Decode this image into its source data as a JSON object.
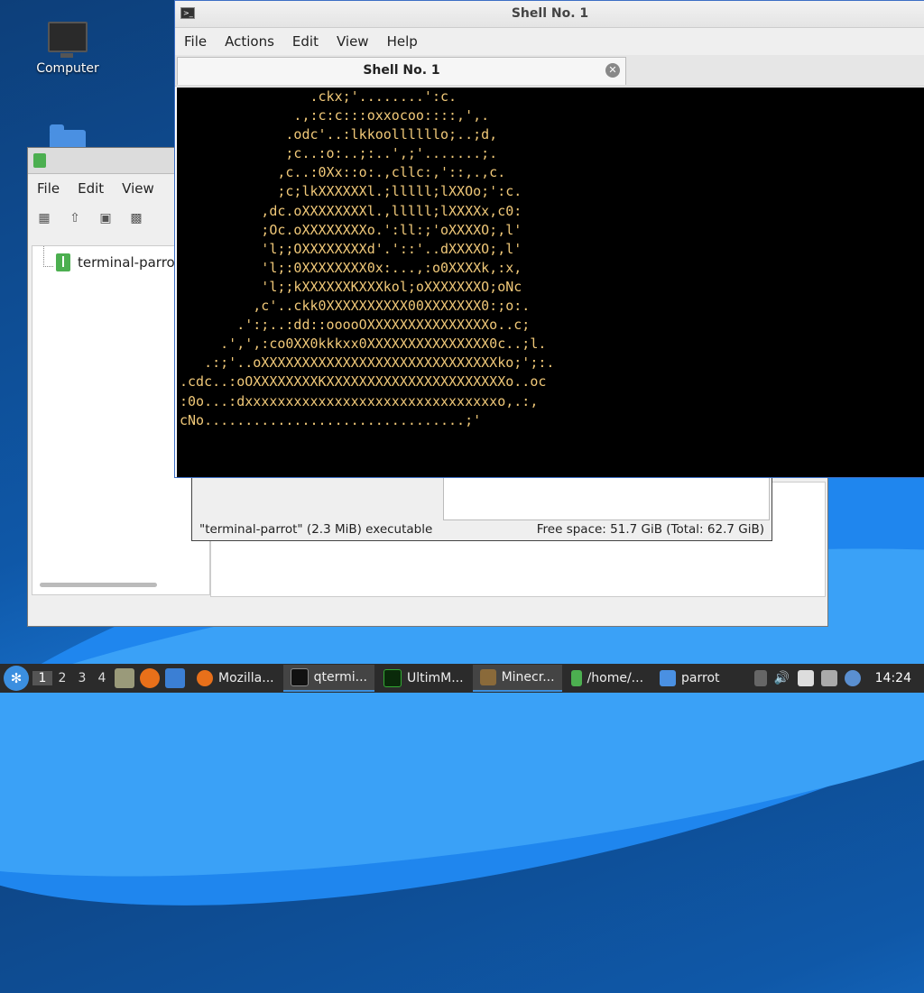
{
  "desktop": {
    "icons": [
      {
        "label": "Computer",
        "icon": "monitor-icon"
      },
      {
        "label": "",
        "icon": "folder-icon"
      }
    ]
  },
  "file_manager": {
    "menu": [
      "File",
      "Edit",
      "View"
    ],
    "tree_item": "terminal-parrot"
  },
  "properties_dialog": {
    "status_left": "\"terminal-parrot\" (2.3 MiB) executable",
    "status_right": "Free space: 51.7 GiB (Total: 62.7 GiB)"
  },
  "terminal": {
    "window_title": "Shell No. 1",
    "menu": [
      "File",
      "Actions",
      "Edit",
      "View",
      "Help"
    ],
    "tab_label": "Shell No. 1",
    "text_color": "#f0c878",
    "lines": [
      "                .ckx;'........':c.",
      "              .,:c:c:::oxxocoo::::,',.",
      "             .odc'..:lkkoollllllo;..;d,",
      "             ;c..:o:..;:..',;'.......;.",
      "            ,c..:0Xx::o:.,cllc:,'::,.,c.",
      "            ;c;lkXXXXXXl.;lllll;lXXOo;':c.",
      "          ,dc.oXXXXXXXXl.,lllll;lXXXXx,c0:",
      "          ;Oc.oXXXXXXXXo.':ll:;'oXXXXO;,l'",
      "          'l;;OXXXXXXXXd'.'::'..dXXXXO;,l'",
      "          'l;:0XXXXXXXX0x:...,:o0XXXXk,:x,",
      "          'l;;kXXXXXXKXXXkol;oXXXXXXXO;oNc",
      "         ,c'..ckk0XXXXXXXXXX00XXXXXXX0:;o:.",
      "       .':;..:dd::ooooOXXXXXXXXXXXXXXXo..c;",
      "     .',',:co0XX0kkkxx0XXXXXXXXXXXXXXX0c..;l.",
      "   .:;'..oXXXXXXXXXXXXXXXXXXXXXXXXXXXXXko;';:.",
      ".cdc..:oOXXXXXXXXKXXXXXXXXXXXXXXXXXXXXXXo..oc",
      ":0o...:dxxxxxxxxxxxxxxxxxxxxxxxxxxxxxxxo,.:,",
      "cNo................................;'"
    ]
  },
  "taskbar": {
    "workspaces": [
      "1",
      "2",
      "3",
      "4"
    ],
    "active_workspace": "1",
    "tasks": [
      {
        "label": "Mozilla...",
        "icon": "firefox-icon"
      },
      {
        "label": "qtermi...",
        "icon": "terminal-icon"
      },
      {
        "label": "UltimM...",
        "icon": "terminal-icon"
      },
      {
        "label": "Minecr...",
        "icon": "minecraft-icon"
      },
      {
        "label": "/home/...",
        "icon": "archive-icon"
      },
      {
        "label": "parrot",
        "icon": "folder-icon"
      }
    ],
    "clock": "14:24"
  }
}
